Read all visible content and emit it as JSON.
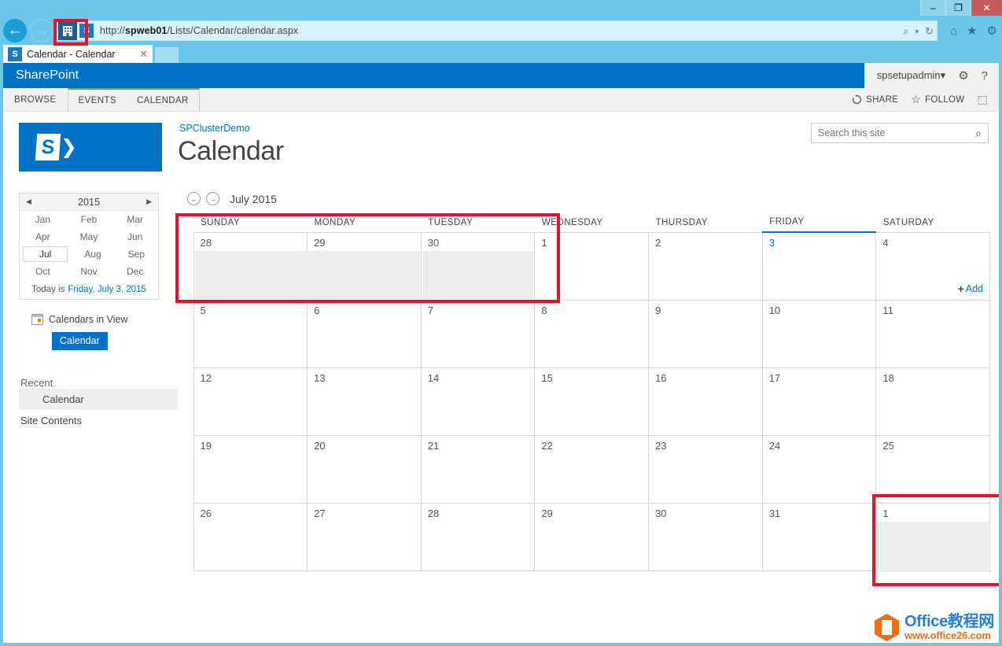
{
  "window": {
    "minimize_label": "–",
    "maximize_label": "❐",
    "close_label": "✕"
  },
  "browser": {
    "back_icon": "←",
    "forward_icon": "→",
    "url_prefix": "http://",
    "url_host": "spweb01",
    "url_path": "/Lists/Calendar/calendar.aspx",
    "enterprise_icon": "enterprise-mode-icon",
    "site_icon_label": "S",
    "search_icon": "⌕",
    "search_caret": "▾",
    "refresh_icon": "↻",
    "home_icon": "⌂",
    "favorites_icon": "★",
    "settings_icon": "⚙",
    "tab_title": "Calendar - Calendar",
    "tab_close": "✕"
  },
  "suitebar": {
    "brand": "SharePoint",
    "user": "spsetupadmin",
    "user_caret": "▾",
    "settings_icon": "⚙",
    "help_icon": "?"
  },
  "ribbon": {
    "browse_tab": "BROWSE",
    "tabs": [
      {
        "label": "EVENTS"
      },
      {
        "label": "CALENDAR"
      }
    ],
    "share_label": "SHARE",
    "share_icon": "↻",
    "follow_label": "FOLLOW",
    "follow_icon": "☆",
    "focus_icon": "⬚"
  },
  "sidebar": {
    "logo_letter": "S",
    "logo_arrow": "❯",
    "minical": {
      "prev_arrow": "◀",
      "next_arrow": "▶",
      "year": "2015",
      "months": [
        "Jan",
        "Feb",
        "Mar",
        "Apr",
        "May",
        "Jun",
        "Jul",
        "Aug",
        "Sep",
        "Oct",
        "Nov",
        "Dec"
      ],
      "selected_month": "Jul",
      "today_prefix": "Today is",
      "today_date": "Friday, July 3, 2015"
    },
    "calendars_in_view_label": "Calendars in View",
    "calendars_in_view_icon": "calendar-grid-icon",
    "calendar_chip": "Calendar",
    "recent_heading": "Recent",
    "recent_items": [
      {
        "label": "Calendar",
        "selected": true
      }
    ],
    "site_contents": "Site Contents"
  },
  "main": {
    "breadcrumb": "SPClusterDemo",
    "page_title": "Calendar",
    "search": {
      "placeholder": "Search this site",
      "value": "",
      "icon": "⌕"
    },
    "calnav": {
      "prev_icon": "←",
      "next_icon": "→",
      "month_label": "July 2015"
    },
    "add_label": "Add",
    "add_plus": "+"
  },
  "calendar_grid": {
    "day_headers": [
      "SUNDAY",
      "MONDAY",
      "TUESDAY",
      "WEDNESDAY",
      "THURSDAY",
      "FRIDAY",
      "SATURDAY"
    ],
    "weeks": [
      [
        {
          "day": "28",
          "other_month": true
        },
        {
          "day": "29",
          "other_month": true
        },
        {
          "day": "30",
          "other_month": true
        },
        {
          "day": "1",
          "other_month": false
        },
        {
          "day": "2",
          "other_month": false
        },
        {
          "day": "3",
          "other_month": false,
          "today": true
        },
        {
          "day": "4",
          "other_month": false,
          "show_add": true
        }
      ],
      [
        {
          "day": "5"
        },
        {
          "day": "6"
        },
        {
          "day": "7"
        },
        {
          "day": "8"
        },
        {
          "day": "9"
        },
        {
          "day": "10"
        },
        {
          "day": "11"
        }
      ],
      [
        {
          "day": "12"
        },
        {
          "day": "13"
        },
        {
          "day": "14"
        },
        {
          "day": "15"
        },
        {
          "day": "16"
        },
        {
          "day": "17"
        },
        {
          "day": "18"
        }
      ],
      [
        {
          "day": "19"
        },
        {
          "day": "20"
        },
        {
          "day": "21"
        },
        {
          "day": "22"
        },
        {
          "day": "23"
        },
        {
          "day": "24"
        },
        {
          "day": "25"
        }
      ],
      [
        {
          "day": "26"
        },
        {
          "day": "27"
        },
        {
          "day": "28"
        },
        {
          "day": "29"
        },
        {
          "day": "30"
        },
        {
          "day": "31"
        },
        {
          "day": "1",
          "other_month": true
        }
      ]
    ]
  },
  "annotations": {
    "accent_red": "#e8112d",
    "boxes": [
      "enterprise-mode-icon",
      "first-week-row",
      "august-first-cell"
    ]
  },
  "watermark": {
    "line1": "Office教程网",
    "line2": "www.office26.com"
  }
}
